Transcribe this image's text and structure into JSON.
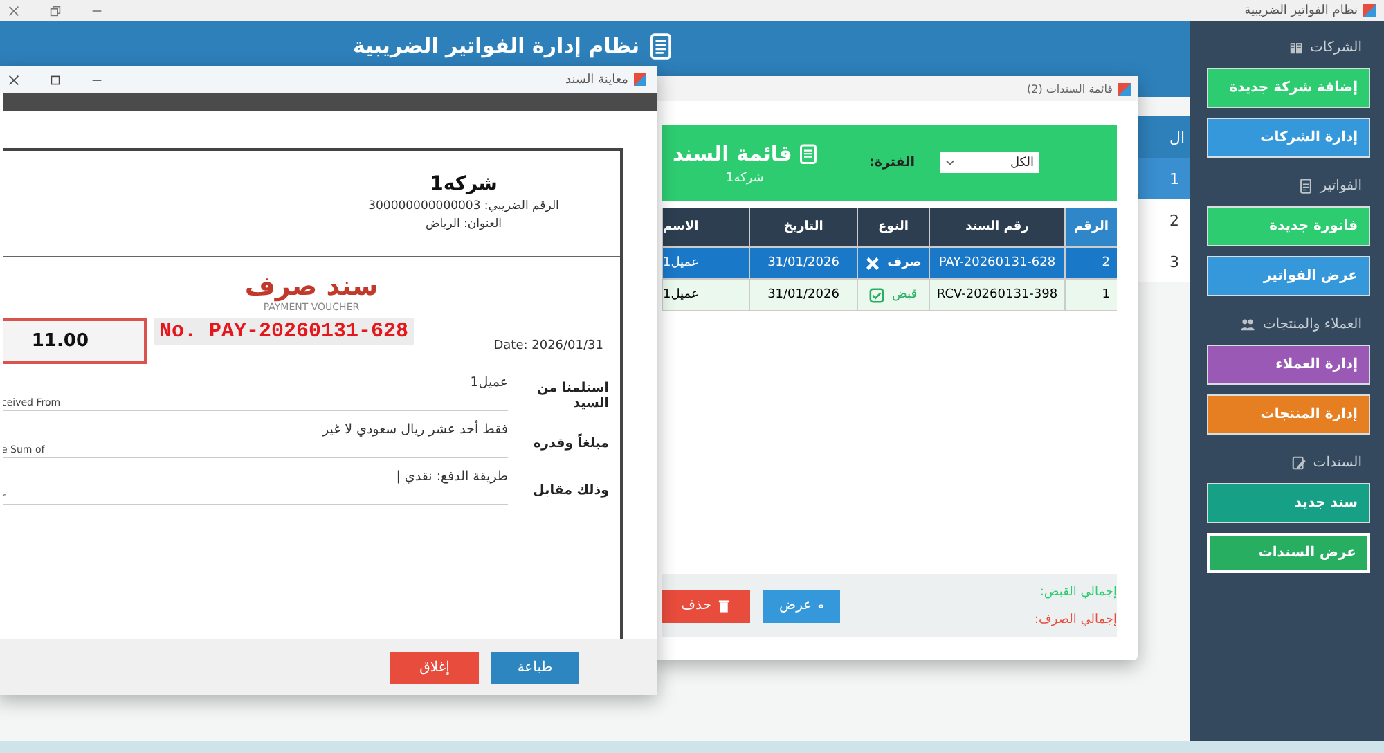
{
  "app": {
    "title": "نظام الفواتير الضريبية"
  },
  "header": {
    "title": "نظام إدارة الفواتير الضريبية"
  },
  "sidebar": {
    "sections": [
      {
        "title": "الشركات",
        "kind": "building",
        "buttons": [
          {
            "label": "إضافة شركة جديدة",
            "color": "#2ecc71",
            "selected": false
          },
          {
            "label": "إدارة الشركات",
            "color": "#3498db",
            "selected": false
          }
        ]
      },
      {
        "title": "الفواتير",
        "kind": "document",
        "buttons": [
          {
            "label": "فاتورة جديدة",
            "color": "#2ecc71",
            "selected": false
          },
          {
            "label": "عرض الفواتير",
            "color": "#3498db",
            "selected": false
          }
        ]
      },
      {
        "title": "العملاء والمنتجات",
        "kind": "people",
        "buttons": [
          {
            "label": "إدارة العملاء",
            "color": "#9b59b6",
            "selected": false
          },
          {
            "label": "إدارة المنتجات",
            "color": "#e67e22",
            "selected": false
          }
        ]
      },
      {
        "title": "السندات",
        "kind": "edit",
        "buttons": [
          {
            "label": "سند جديد",
            "color": "#16a085",
            "selected": false
          },
          {
            "label": "عرض السندات",
            "color": "#27ae60",
            "selected": true
          }
        ]
      }
    ]
  },
  "background_table": {
    "columns": [
      "ال"
    ],
    "rows": [
      {
        "cells": [
          "1"
        ],
        "selected": true
      },
      {
        "cells": [
          "2"
        ],
        "selected": false
      },
      {
        "cells": [
          "3"
        ],
        "selected": false
      }
    ]
  },
  "voucher_list": {
    "window_title": "قائمة السندات (2)",
    "title": "قائمة السند",
    "subtitle": "شركه1",
    "filter_label": "الفترة:",
    "filter_value": "الكل",
    "columns": [
      "الرقم",
      "رقم السند",
      "النوع",
      "التاريخ",
      "الاسم"
    ],
    "rows": [
      {
        "number": "2",
        "voucher_no": "PAY-20260131-628",
        "type": "صرف",
        "kind": "payment",
        "date": "31/01/2026",
        "name": "عميل1",
        "selected": true
      },
      {
        "number": "1",
        "voucher_no": "RCV-20260131-398",
        "type": "قبض",
        "kind": "receipt",
        "date": "31/01/2026",
        "name": "عميل1",
        "selected": false
      }
    ],
    "buttons": [
      {
        "label": "عرض",
        "kind": "view"
      },
      {
        "label": "حذف",
        "kind": "delete"
      }
    ],
    "totals": [
      {
        "label": "إجمالي القبض:",
        "kind": "receipt"
      },
      {
        "label": "إجمالي الصرف:",
        "kind": "payment"
      }
    ]
  },
  "preview": {
    "window_title": "معاينة السند",
    "company": "شركه1",
    "tax_label": "الرقم  الضريبي:",
    "tax_number": "300000000000003",
    "address": "العنوان: الرياض",
    "voucher_title": "سند صرف",
    "voucher_subtitle": "PAYMENT VOUCHER",
    "amount": "11.00",
    "number": "No. PAY-20260131-628",
    "date": "Date: 2026/01/31",
    "fields": [
      {
        "label": "استلمنا من السيد",
        "value": "عميل1",
        "english": "ceived From"
      },
      {
        "label": "مبلغاً وقدره",
        "value": "فقط أحد عشر ريال سعودي لا غير",
        "english": "e Sum of"
      },
      {
        "label": "وذلك مقابل",
        "value": "طريقة الدفع: نقدي |",
        "english": "r"
      }
    ],
    "buttons": [
      {
        "label": "طباعة",
        "kind": "print"
      },
      {
        "label": "إغلاق",
        "kind": "close"
      }
    ]
  }
}
